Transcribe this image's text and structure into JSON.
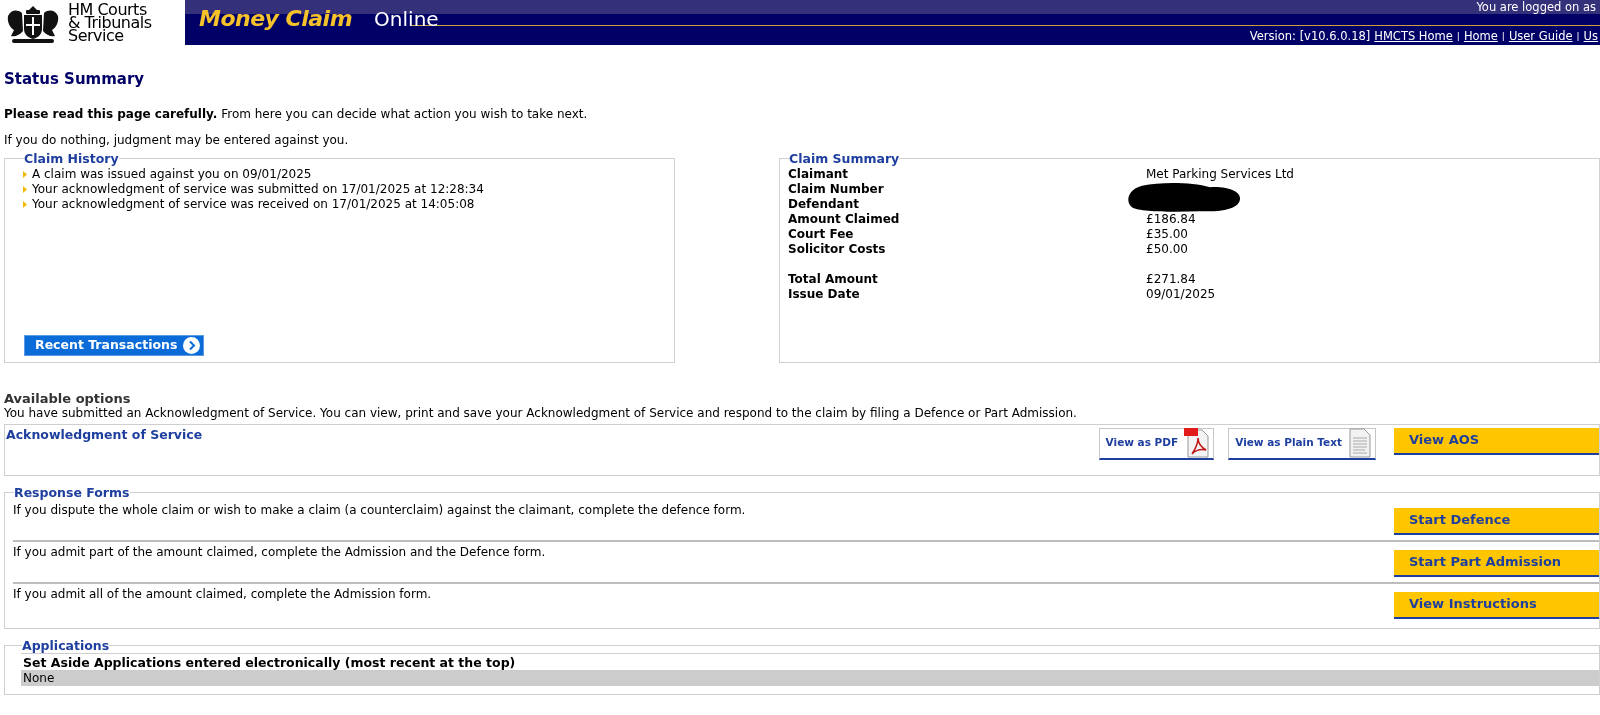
{
  "header": {
    "logo_lines": [
      "HM Courts",
      "& Tribunals",
      "Service"
    ],
    "brand_primary": "Money Claim",
    "brand_secondary": "Online",
    "logged_on": "You are logged on as",
    "version": "Version: [v10.6.0.18]",
    "link_separator": "|",
    "links": [
      "HMCTS Home",
      "Home",
      "User Guide",
      "Us"
    ]
  },
  "page_title": "Status Summary",
  "intro": "**Please read this page carefully.** From here you can decide what action you wish to take next.",
  "warning": "If you do nothing, judgment may be entered against you.",
  "claim_history": {
    "title": "Claim History",
    "events": [
      "A claim was issued against you on 09/01/2025",
      "Your acknowledgment of service was submitted on 17/01/2025 at 12:28:34",
      "Your acknowledgment of service was received on 17/01/2025 at 14:05:08"
    ],
    "button": "Recent Transactions"
  },
  "claim_summary": {
    "title": "Claim Summary",
    "rows": [
      {
        "label": "Claimant",
        "value": "Met Parking Services Ltd"
      },
      {
        "label": "Claim Number"
      },
      {
        "label": "Defendant"
      },
      {
        "label": "Amount Claimed",
        "value": "£186.84"
      },
      {
        "label": "Court Fee",
        "value": "£35.00"
      },
      {
        "label": "Solicitor Costs",
        "value": "£50.00"
      }
    ],
    "totals": [
      {
        "label": "Total Amount",
        "value": "£271.84"
      },
      {
        "label": "Issue Date",
        "value": "09/01/2025"
      }
    ]
  },
  "options": {
    "title": "Available options",
    "text": "You have submitted an Acknowledgment of Service. You can view, print and save your Acknowledgment of Service and respond to the claim by filing a Defence or Part Admission."
  },
  "aos": {
    "title": "Acknowledgment of Service",
    "buttons": [
      {
        "kind": "pdf",
        "label": "View as PDF"
      },
      {
        "kind": "text",
        "label": "View as Plain Text"
      },
      {
        "kind": "primary",
        "label": "View AOS"
      }
    ]
  },
  "response_forms": {
    "title": "Response Forms",
    "rows": [
      {
        "text": "If you dispute the whole claim or wish to make a claim (a counterclaim) against the claimant, complete the defence form.",
        "button": "Start Defence"
      },
      {
        "text": "If you admit part of the amount claimed, complete the Admission and the Defence form.",
        "button": "Start Part Admission"
      },
      {
        "text": "If you admit all of the amount claimed, complete the Admission form.",
        "button": "View Instructions"
      }
    ]
  },
  "applications": {
    "title": "Applications",
    "table_heading": "Set Aside Applications entered electronically (most recent at the top)",
    "rows": [
      "None"
    ]
  }
}
